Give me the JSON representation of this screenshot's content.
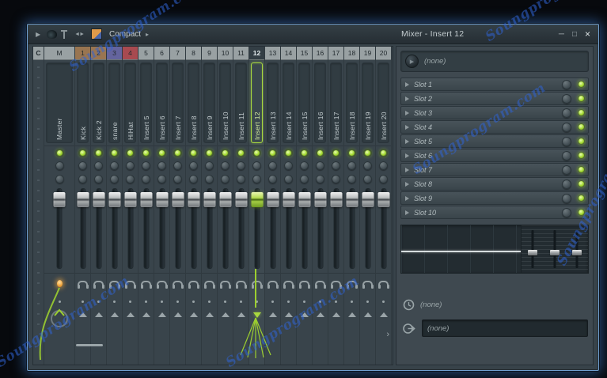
{
  "window": {
    "title": "Mixer - Insert 12",
    "minimize": "─",
    "maximize": "□",
    "close": "×"
  },
  "toolbar": {
    "menu_arrow": "▶",
    "dock_icon": "◄►",
    "layout_label": "Compact",
    "layout_arrow": "▸"
  },
  "mixer": {
    "corner_label": "C",
    "master_header": "M",
    "master_name": "Master",
    "scroll_right": "›",
    "channels": [
      {
        "num": "1",
        "name": "Kick",
        "color": "#997551",
        "selected": false
      },
      {
        "num": "2",
        "name": "Kick 2",
        "color": "#997551",
        "selected": false
      },
      {
        "num": "3",
        "name": "snare",
        "color": "#64649e",
        "selected": false
      },
      {
        "num": "4",
        "name": "HiHat",
        "color": "#a84a50",
        "selected": false
      },
      {
        "num": "5",
        "name": "Insert 5",
        "color": "",
        "selected": false
      },
      {
        "num": "6",
        "name": "Insert 6",
        "color": "",
        "selected": false
      },
      {
        "num": "7",
        "name": "Insert 7",
        "color": "",
        "selected": false
      },
      {
        "num": "8",
        "name": "Insert 8",
        "color": "",
        "selected": false
      },
      {
        "num": "9",
        "name": "Insert 9",
        "color": "",
        "selected": false
      },
      {
        "num": "10",
        "name": "Insert 10",
        "color": "",
        "selected": false
      },
      {
        "num": "11",
        "name": "Insert 11",
        "color": "",
        "selected": false
      },
      {
        "num": "12",
        "name": "Insert 12",
        "color": "",
        "selected": true
      },
      {
        "num": "13",
        "name": "Insert 13",
        "color": "",
        "selected": false
      },
      {
        "num": "14",
        "name": "Insert 14",
        "color": "",
        "selected": false
      },
      {
        "num": "15",
        "name": "Insert 15",
        "color": "",
        "selected": false
      },
      {
        "num": "16",
        "name": "Insert 16",
        "color": "",
        "selected": false
      },
      {
        "num": "17",
        "name": "Insert 17",
        "color": "",
        "selected": false
      },
      {
        "num": "18",
        "name": "Insert 18",
        "color": "",
        "selected": false
      },
      {
        "num": "19",
        "name": "Insert 19",
        "color": "",
        "selected": false
      },
      {
        "num": "20",
        "name": "Insert 20",
        "color": "",
        "selected": false
      }
    ]
  },
  "panel": {
    "source_icon": "▶",
    "source_value": "(none)",
    "slots": [
      {
        "label": "Slot 1"
      },
      {
        "label": "Slot 2"
      },
      {
        "label": "Slot 3"
      },
      {
        "label": "Slot 4"
      },
      {
        "label": "Slot 5"
      },
      {
        "label": "Slot 6"
      },
      {
        "label": "Slot 7"
      },
      {
        "label": "Slot 8"
      },
      {
        "label": "Slot 9"
      },
      {
        "label": "Slot 10"
      }
    ],
    "time_value": "(none)",
    "output_value": "(none)"
  },
  "colors": {
    "accent": "#a9d93f",
    "led": "#a3d832",
    "watermark": "#2f63d4"
  },
  "watermark": {
    "text": "Soungprogram.com"
  }
}
